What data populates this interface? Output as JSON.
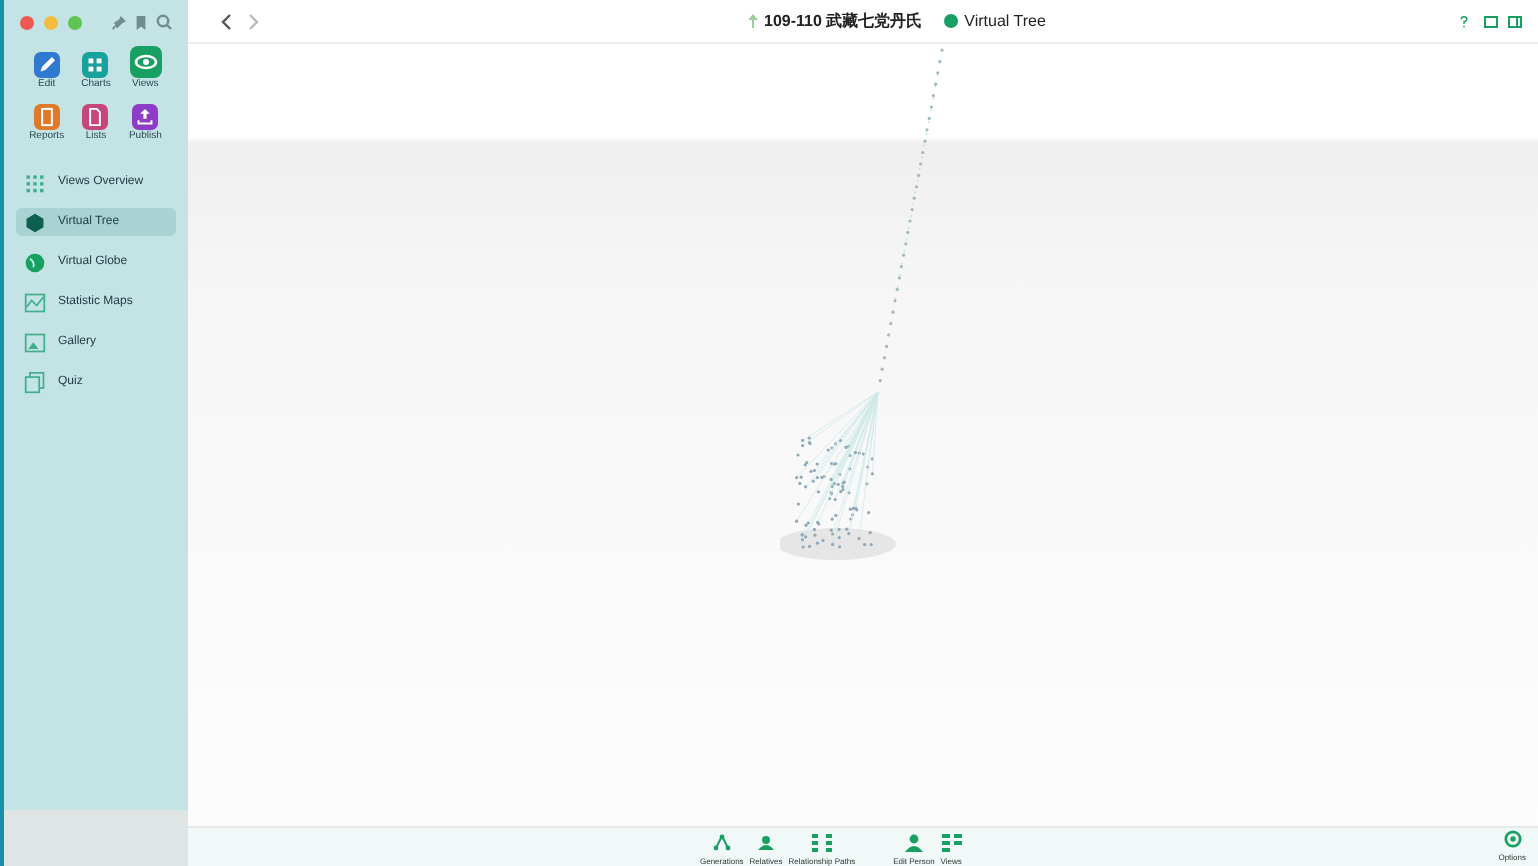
{
  "titlebar": {
    "breadcrumb": "109-110 武藏七党丹氏",
    "view": "Virtual Tree"
  },
  "sidebar": {
    "tools": [
      {
        "label": "Edit",
        "color": "#2f7ad1",
        "selected": false
      },
      {
        "label": "Charts",
        "color": "#17a39b",
        "selected": false
      },
      {
        "label": "Views",
        "color": "#17a061",
        "selected": true
      },
      {
        "label": "Reports",
        "color": "#e07a2a",
        "selected": false
      },
      {
        "label": "Lists",
        "color": "#c4467a",
        "selected": false
      },
      {
        "label": "Publish",
        "color": "#8e3cc7",
        "selected": false
      }
    ],
    "items": [
      {
        "label": "Views Overview",
        "selected": false
      },
      {
        "label": "Virtual Tree",
        "selected": true
      },
      {
        "label": "Virtual Globe",
        "selected": false
      },
      {
        "label": "Statistic Maps",
        "selected": false
      },
      {
        "label": "Gallery",
        "selected": false
      },
      {
        "label": "Quiz",
        "selected": false
      }
    ]
  },
  "toolbar": {
    "buttons": [
      "Generations",
      "Relatives",
      "Relationship Paths",
      "Edit Person",
      "Views"
    ],
    "options": "Options"
  }
}
